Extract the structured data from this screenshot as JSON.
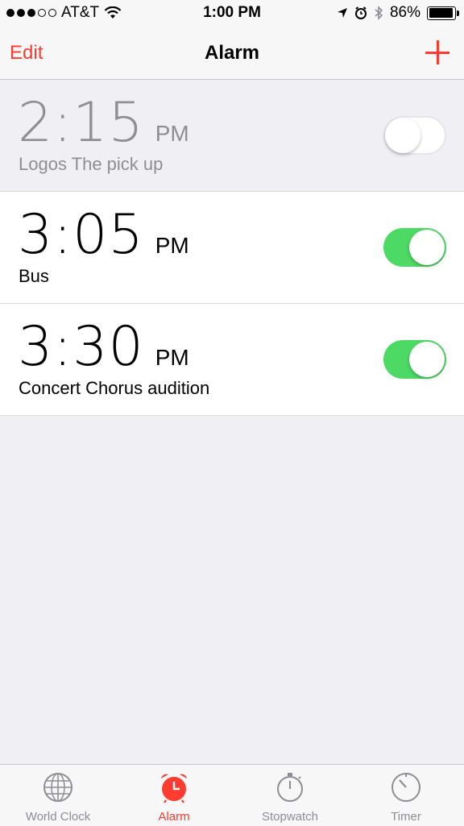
{
  "status_bar": {
    "carrier": "AT&T",
    "time": "1:00 PM",
    "battery": "86%"
  },
  "nav": {
    "edit_label": "Edit",
    "title": "Alarm"
  },
  "alarms": [
    {
      "time": "2:15",
      "ampm": "PM",
      "label": "Logos The pick up",
      "enabled": false
    },
    {
      "time": "3:05",
      "ampm": "PM",
      "label": "Bus",
      "enabled": true
    },
    {
      "time": "3:30",
      "ampm": "PM",
      "label": "Concert Chorus audition",
      "enabled": true
    }
  ],
  "tabs": [
    {
      "label": "World Clock",
      "icon": "globe-icon",
      "active": false
    },
    {
      "label": "Alarm",
      "icon": "alarm-clock-icon",
      "active": true
    },
    {
      "label": "Stopwatch",
      "icon": "stopwatch-icon",
      "active": false
    },
    {
      "label": "Timer",
      "icon": "timer-icon",
      "active": false
    }
  ],
  "colors": {
    "accent": "#ff3b30",
    "toggle_on": "#4cd964"
  }
}
